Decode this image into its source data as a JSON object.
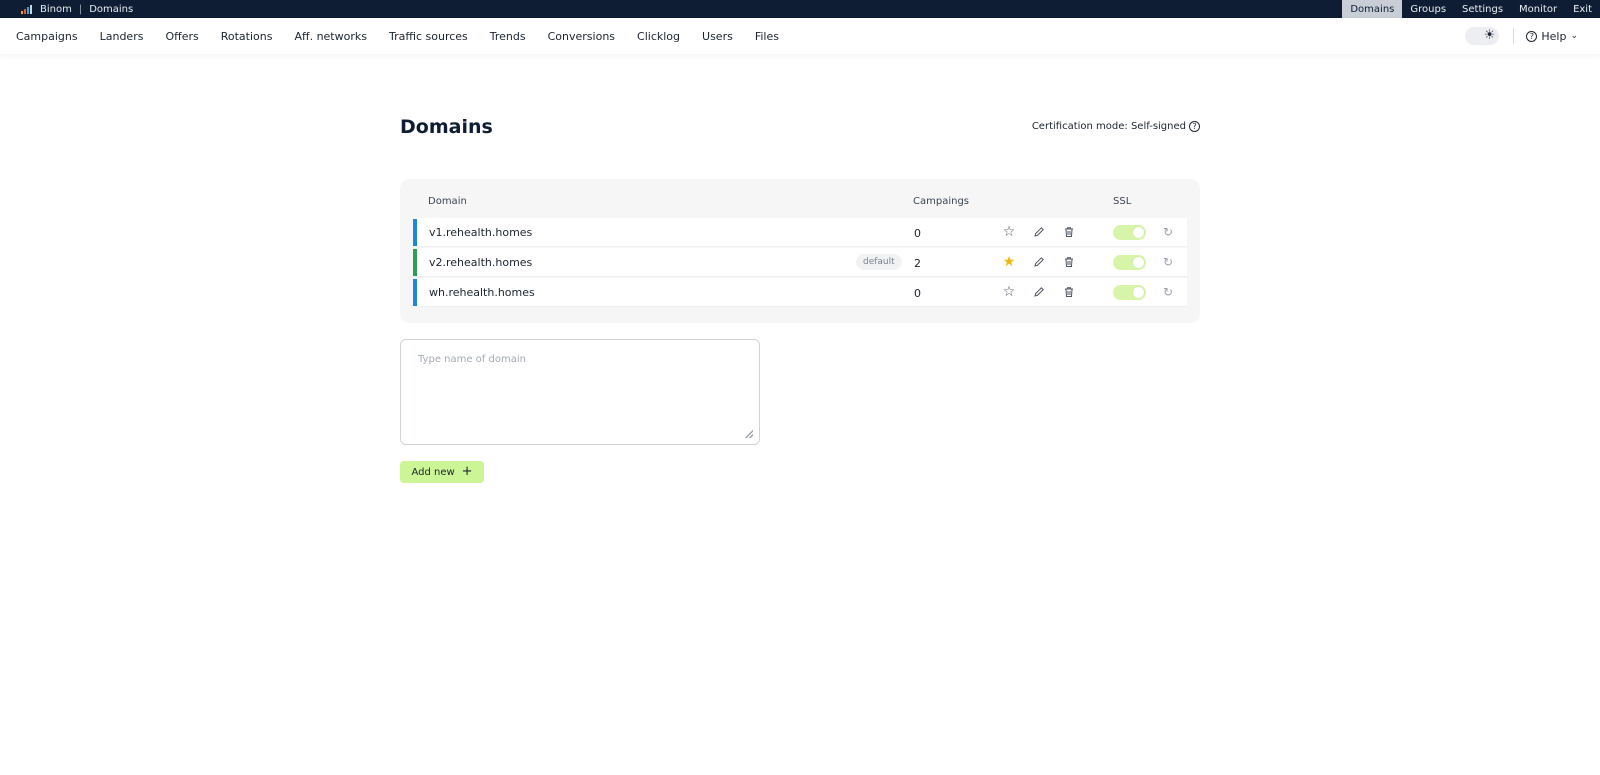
{
  "topbar": {
    "brand": "Binom",
    "section": "Domains",
    "nav": [
      {
        "label": "Domains",
        "active": true
      },
      {
        "label": "Groups",
        "active": false
      },
      {
        "label": "Settings",
        "active": false
      },
      {
        "label": "Monitor",
        "active": false
      },
      {
        "label": "Exit",
        "active": false
      }
    ]
  },
  "mainnav": {
    "items": [
      "Campaigns",
      "Landers",
      "Offers",
      "Rotations",
      "Aff. networks",
      "Traffic sources",
      "Trends",
      "Conversions",
      "Clicklog",
      "Users",
      "Files"
    ],
    "help_label": "Help",
    "theme_icon": "sun-icon"
  },
  "page": {
    "title": "Domains",
    "cert_label": "Certification mode:",
    "cert_value": "Self-signed"
  },
  "table": {
    "headers": {
      "domain": "Domain",
      "campaigns": "Campaings",
      "ssl": "SSL"
    },
    "rows": [
      {
        "domain": "v1.rehealth.homes",
        "badge": "",
        "campaigns": "0",
        "starred": false,
        "accent": "#1e88d6",
        "ssl": true
      },
      {
        "domain": "v2.rehealth.homes",
        "badge": "default",
        "campaigns": "2",
        "starred": true,
        "accent": "#2e9e52",
        "ssl": true
      },
      {
        "domain": "wh.rehealth.homes",
        "badge": "",
        "campaigns": "0",
        "starred": false,
        "accent": "#1e88d6",
        "ssl": true
      }
    ]
  },
  "form": {
    "placeholder": "Type name of domain",
    "add_label": "Add new"
  },
  "colors": {
    "topbar_bg": "#0e1d33",
    "accent_green": "#ccf595",
    "star_active": "#f2b705"
  }
}
